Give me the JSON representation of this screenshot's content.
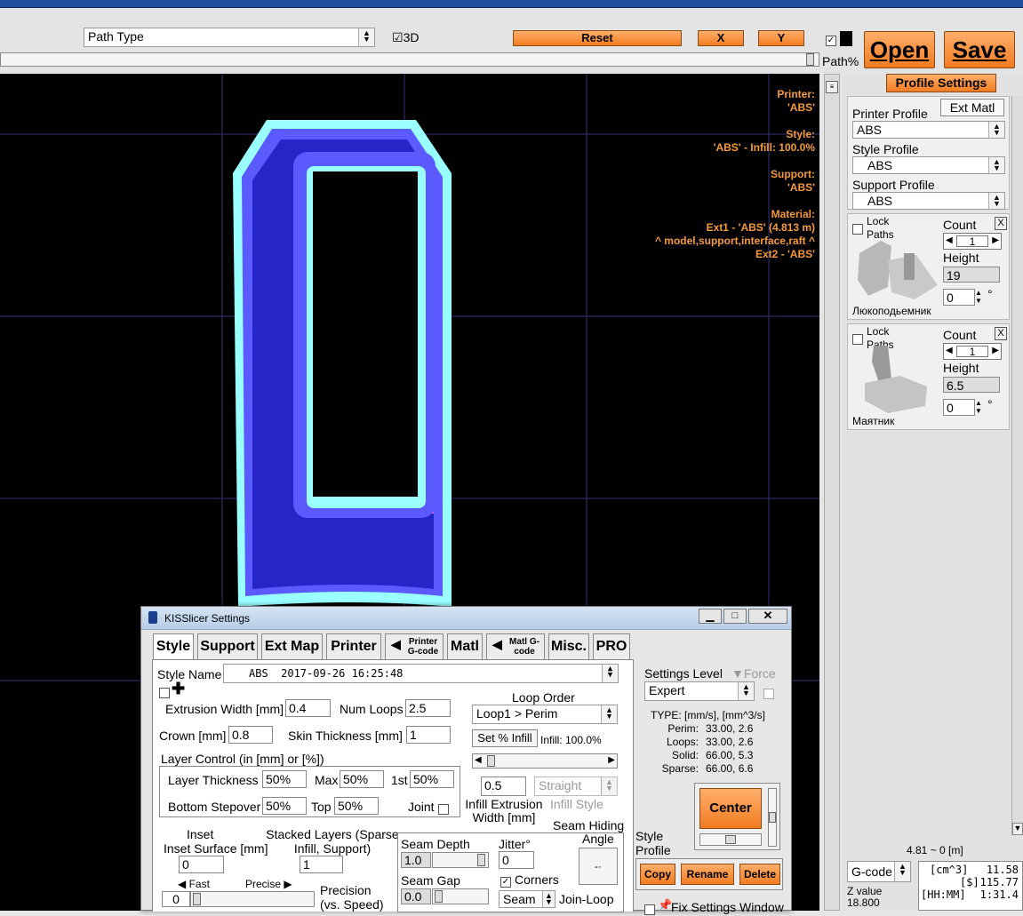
{
  "toolbar": {
    "path_type": "Path Type",
    "three_d_label": "3D",
    "three_d_checked": "☑",
    "reset_label": "Reset",
    "x_label": "X",
    "y_label": "Y",
    "open_label": "Open",
    "save_label": "Save",
    "path_percent_label": "Path%"
  },
  "viewport_info": [
    {
      "label": "Printer:",
      "value": "'ABS'"
    },
    {
      "label": "Style:",
      "value": "'ABS' - Infill: 100.0%"
    },
    {
      "label": "Support:",
      "value": "'ABS'"
    },
    {
      "label": "Material:",
      "value": "Ext1 - 'ABS' (4.813 m)",
      "extra": "^ model,support,interface,raft ^",
      "extra2": "Ext2 - 'ABS'"
    }
  ],
  "right_panel": {
    "profile_settings_label": "Profile Settings",
    "ext_matl_label": "Ext Matl",
    "printer_profile_label": "Printer Profile",
    "printer_profile_value": "ABS",
    "style_profile_label": "Style Profile",
    "style_profile_value": "ABS",
    "support_profile_label": "Support Profile",
    "support_profile_value": "ABS",
    "models": [
      {
        "lock_label": "Lock Paths",
        "count_label": "Count",
        "count": "1",
        "height_label": "Height",
        "height": "19",
        "rotation": "0",
        "deg": "°",
        "name": "Люкоподьемник",
        "close": "X"
      },
      {
        "lock_label": "Lock Paths",
        "count_label": "Count",
        "count": "1",
        "height_label": "Height",
        "height": "6.5",
        "rotation": "0",
        "deg": "°",
        "name": "Маятник",
        "close": "X"
      }
    ],
    "range_label": "4.81 ~ 0 [m]",
    "gcode_select": "G-code",
    "z_value_label": "Z value",
    "z_value": "18.800",
    "stats": [
      {
        "k": "[cm^3]",
        "v": "11.58"
      },
      {
        "k": "[$]",
        "v": "115.77"
      },
      {
        "k": "[HH:MM]",
        "v": "1:31.4"
      }
    ]
  },
  "dialog": {
    "title": "KISSlicer Settings",
    "tabs": [
      "Style",
      "Support",
      "Ext Map",
      "Printer",
      "Printer G-code",
      "Matl",
      "Matl G-code",
      "Misc.",
      "PRO"
    ],
    "style_name_label": "Style Name",
    "style_name_value": "ABS  2017-09-26 16:25:48",
    "extrusion_width_label": "Extrusion Width [mm]",
    "extrusion_width": "0.4",
    "num_loops_label": "Num Loops",
    "num_loops": "2.5",
    "crown_label": "Crown [mm]",
    "crown": "0.8",
    "skin_thickness_label": "Skin Thickness [mm]",
    "skin_thickness": "1",
    "layer_control_label": "Layer Control (in [mm] or [%])",
    "layer_thickness_label": "Layer Thickness",
    "layer_thickness": "50%",
    "max_label": "Max",
    "max": "50%",
    "first_label": "1st",
    "first": "50%",
    "bottom_stepover_label": "Bottom Stepover",
    "bottom_stepover": "50%",
    "top_label": "Top",
    "top": "50%",
    "joint_label": "Joint",
    "loop_order_label": "Loop Order",
    "loop_order": "Loop1 > Perim",
    "set_infill_label": "Set % Infill",
    "infill_label": "Infill: 100.0%",
    "infill_ext_width": "0.5",
    "infill_ext_label": "Infill Extrusion Width [mm]",
    "infill_style": "Straight",
    "infill_style_label": "Infill Style",
    "inset_surface_label": "Inset Surface [mm]",
    "inset_surface": "0",
    "stacked_layers_label": "Stacked Layers (Sparse Infill, Support)",
    "stacked_layers": "1",
    "fast_label": "Fast",
    "precise_label": "Precise",
    "precision_value": "0",
    "precision_label": "Precision (vs. Speed)",
    "seam_hiding_label": "Seam Hiding",
    "seam_depth_label": "Seam Depth",
    "seam_depth": "1.0",
    "jitter_label": "Jitter°",
    "jitter": "0",
    "angle_label": "Angle",
    "seam_gap_label": "Seam Gap",
    "seam_gap": "0.0",
    "corners_label": "Corners",
    "seam_select": "Seam",
    "join_loop_label": "Join-Loop",
    "settings_level_label": "Settings Level",
    "force_label": "Force",
    "settings_level": "Expert",
    "type_header": "TYPE: [mm/s], [mm^3/s]",
    "type_rows": [
      {
        "k": "Perim:",
        "v": "33.00,  2.6"
      },
      {
        "k": "Loops:",
        "v": "33.00,  2.6"
      },
      {
        "k": "Solid:",
        "v": "66.00,  5.3"
      },
      {
        "k": "Sparse:",
        "v": "66.00,  6.6"
      }
    ],
    "center_label": "Center",
    "style_profile_label": "Style Profile",
    "copy_label": "Copy",
    "rename_label": "Rename",
    "delete_label": "Delete",
    "fix_settings_label": "Fix Settings Window"
  }
}
